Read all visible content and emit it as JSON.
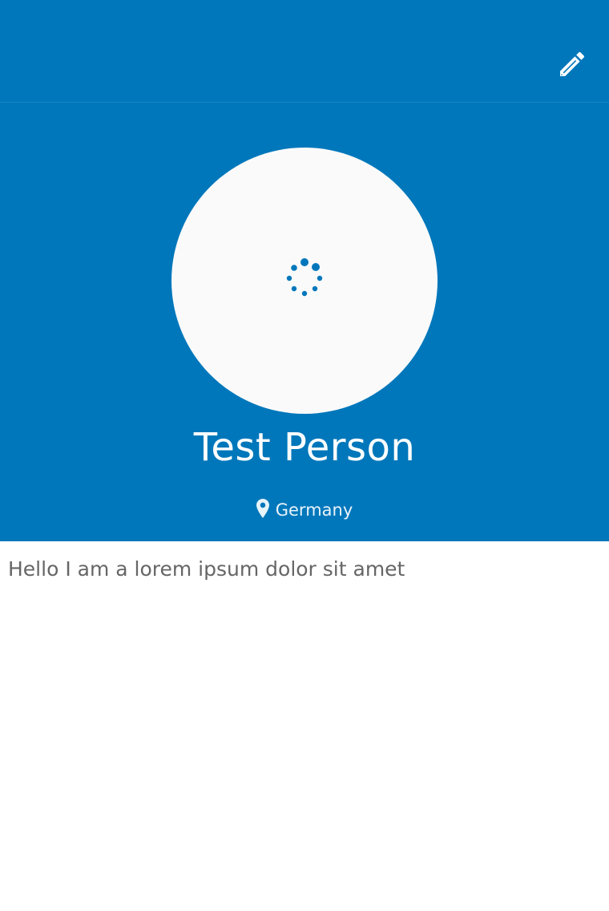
{
  "header": {
    "edit_icon": "pencil-icon"
  },
  "profile": {
    "avatar_state": "loading",
    "spinner_icon": "loading-spinner-icon",
    "name": "Test Person",
    "location_icon": "map-pin-icon",
    "location": "Germany",
    "bio": "Hello I am a lorem ipsum dolor sit amet"
  },
  "colors": {
    "primary": "#0077bb",
    "avatar_bg": "#fafafa",
    "text_light": "#ffffff",
    "bio_text": "#666666"
  }
}
